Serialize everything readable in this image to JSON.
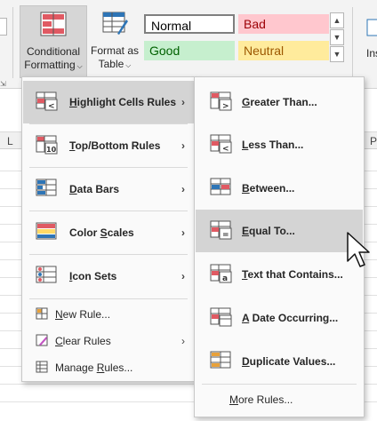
{
  "ribbon": {
    "conditional_formatting": {
      "line1": "Conditional",
      "line2": "Formatting"
    },
    "format_as_table": {
      "line1": "Format as",
      "line2": "Table"
    },
    "styles": {
      "normal": "Normal",
      "bad": "Bad",
      "good": "Good",
      "neutral": "Neutral"
    },
    "insert_partial": "Ins"
  },
  "sheet": {
    "col_left": "L",
    "col_right": "P"
  },
  "menu1": {
    "items": [
      {
        "label_u": "H",
        "label_rest": "ighlight Cells Rules",
        "has_sub": true,
        "highlighted": true
      },
      {
        "label_u": "T",
        "label_rest": "op/Bottom Rules",
        "has_sub": true
      },
      {
        "label_u": "D",
        "label_rest": "ata Bars",
        "has_sub": true
      },
      {
        "label_pre": "Color ",
        "label_u": "S",
        "label_rest": "cales",
        "has_sub": true
      },
      {
        "label_u": "I",
        "label_rest": "con Sets",
        "has_sub": true
      }
    ],
    "small_items": [
      {
        "label_u": "N",
        "label_rest": "ew Rule..."
      },
      {
        "label_u": "C",
        "label_rest": "lear Rules",
        "has_sub": true
      },
      {
        "label_pre": "Manage ",
        "label_u": "R",
        "label_rest": "ules..."
      }
    ]
  },
  "menu2": {
    "items": [
      {
        "label_u": "G",
        "label_rest": "reater Than..."
      },
      {
        "label_u": "L",
        "label_rest": "ess Than..."
      },
      {
        "label_u": "B",
        "label_rest": "etween..."
      },
      {
        "label_u": "E",
        "label_rest": "qual To...",
        "highlighted": true
      },
      {
        "label_u": "T",
        "label_rest": "ext that Contains..."
      },
      {
        "label_u": "A",
        "label_rest": " Date Occurring..."
      },
      {
        "label_u": "D",
        "label_rest": "uplicate Values..."
      }
    ],
    "more": {
      "label_pre": "",
      "label_u": "M",
      "label_rest": "ore Rules..."
    }
  },
  "colors": {
    "highlight": "#d4d4d4",
    "menu_bg": "#fafafa",
    "accent_red": "#e05a63",
    "accent_blue": "#2e75b6"
  }
}
